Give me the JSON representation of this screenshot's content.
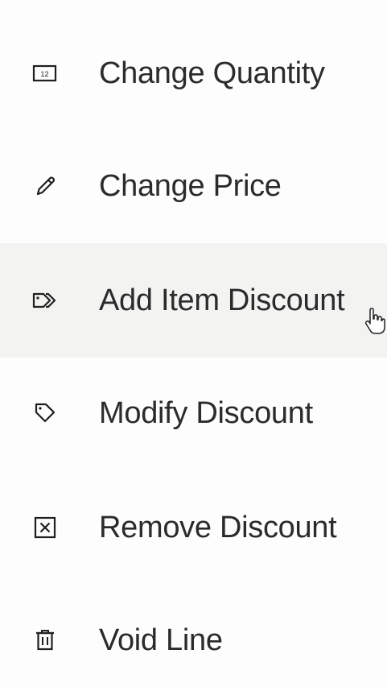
{
  "menu": {
    "items": [
      {
        "label": "Change Quantity",
        "icon": "quantity-box-icon",
        "hovered": false
      },
      {
        "label": "Change Price",
        "icon": "pencil-icon",
        "hovered": false
      },
      {
        "label": "Add Item Discount",
        "icon": "tags-icon",
        "hovered": true
      },
      {
        "label": "Modify Discount",
        "icon": "tag-icon",
        "hovered": false
      },
      {
        "label": "Remove Discount",
        "icon": "close-box-icon",
        "hovered": false
      },
      {
        "label": "Void Line",
        "icon": "trash-icon",
        "hovered": false
      }
    ],
    "quantity_icon_text": "12"
  },
  "colors": {
    "text": "#2b2b2b",
    "hover_background": "#f3f3f2",
    "icon": "#1f1f1f"
  }
}
